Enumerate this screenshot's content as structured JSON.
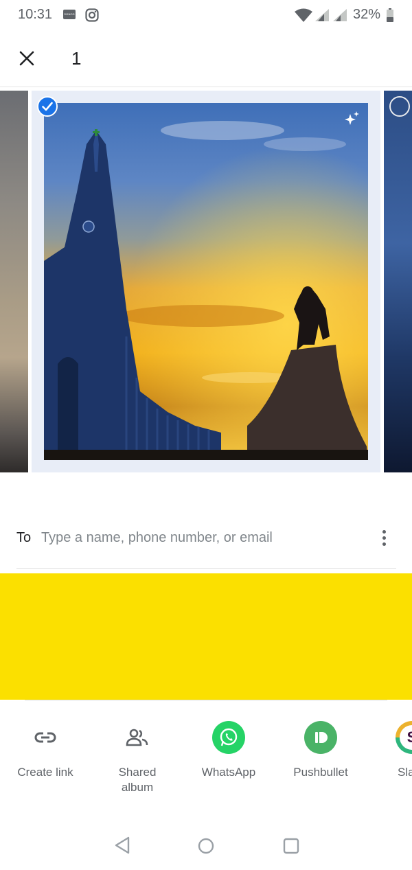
{
  "status_bar": {
    "time": "10:31",
    "battery_percent": "32%",
    "notification_icons": [
      "sonos-icon",
      "instagram-icon"
    ],
    "system_icons": [
      "wifi-icon",
      "signal-icon",
      "signal-icon",
      "battery-icon"
    ]
  },
  "header": {
    "selected_count": "1",
    "close_icon": "close-icon"
  },
  "photos": {
    "selected_index": 1,
    "items": [
      {
        "selected": false,
        "partial": "left"
      },
      {
        "selected": true,
        "has_enhance_sparkle": true
      },
      {
        "selected": false,
        "partial": "right"
      }
    ]
  },
  "recipient": {
    "label": "To",
    "placeholder": "Type a name, phone number, or email",
    "value": ""
  },
  "share_targets": [
    {
      "label": "Create link",
      "icon": "link-icon"
    },
    {
      "label": "Shared\nalbum",
      "icon": "people-icon"
    },
    {
      "label": "WhatsApp",
      "icon": "whatsapp-icon",
      "color": "#25d366"
    },
    {
      "label": "Pushbullet",
      "icon": "pushbullet-icon",
      "color": "#4ab367"
    },
    {
      "label": "Sla",
      "icon": "slack-icon"
    }
  ],
  "colors": {
    "accent_blue": "#1a73e8",
    "highlight_yellow": "#fbe000",
    "selection_frame": "#e8edf7"
  },
  "nav": {
    "buttons": [
      "back-icon",
      "home-icon",
      "recents-icon"
    ]
  }
}
